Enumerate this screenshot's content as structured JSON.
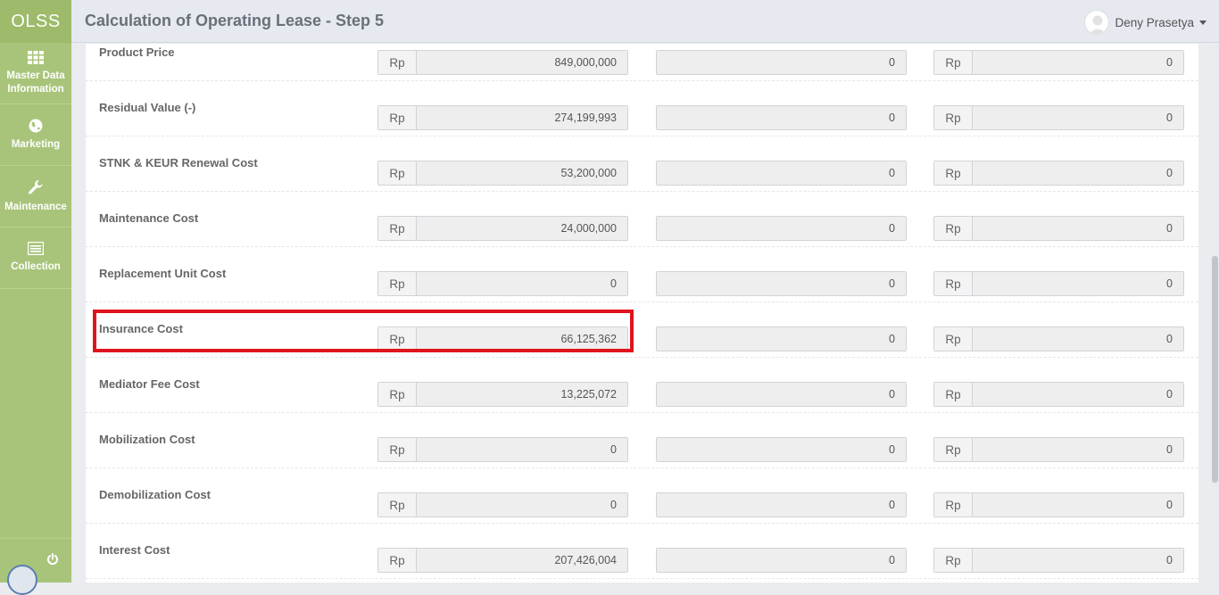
{
  "app": {
    "logo": "OLSS"
  },
  "sidebar": {
    "items": [
      {
        "label": "Master Data Information",
        "icon": "grid-icon"
      },
      {
        "label": "Marketing",
        "icon": "globe-icon"
      },
      {
        "label": "Maintenance",
        "icon": "wrench-icon"
      },
      {
        "label": "Collection",
        "icon": "list-icon"
      }
    ],
    "bottom_icon": "power-icon"
  },
  "header": {
    "title": "Calculation of Operating Lease - Step 5",
    "user_name": "Deny Prasetya"
  },
  "form": {
    "currency": "Rp",
    "rows": [
      {
        "label": "Product Price",
        "col1": "849,000,000",
        "col2": "0",
        "col3": "0"
      },
      {
        "label": "Residual Value (-)",
        "col1": "274,199,993",
        "col2": "0",
        "col3": "0"
      },
      {
        "label": "STNK & KEUR Renewal Cost",
        "col1": "53,200,000",
        "col2": "0",
        "col3": "0"
      },
      {
        "label": "Maintenance Cost",
        "col1": "24,000,000",
        "col2": "0",
        "col3": "0"
      },
      {
        "label": "Replacement Unit Cost",
        "col1": "0",
        "col2": "0",
        "col3": "0"
      },
      {
        "label": "Insurance Cost",
        "col1": "66,125,362",
        "col2": "0",
        "col3": "0"
      },
      {
        "label": "Mediator Fee Cost",
        "col1": "13,225,072",
        "col2": "0",
        "col3": "0"
      },
      {
        "label": "Mobilization Cost",
        "col1": "0",
        "col2": "0",
        "col3": "0"
      },
      {
        "label": "Demobilization Cost",
        "col1": "0",
        "col2": "0",
        "col3": "0"
      },
      {
        "label": "Interest Cost",
        "col1": "207,426,004",
        "col2": "0",
        "col3": "0"
      }
    ]
  },
  "colors": {
    "sidebar": "#a8c47a",
    "highlight": "#e0141e",
    "header": "#e6e9f0"
  }
}
